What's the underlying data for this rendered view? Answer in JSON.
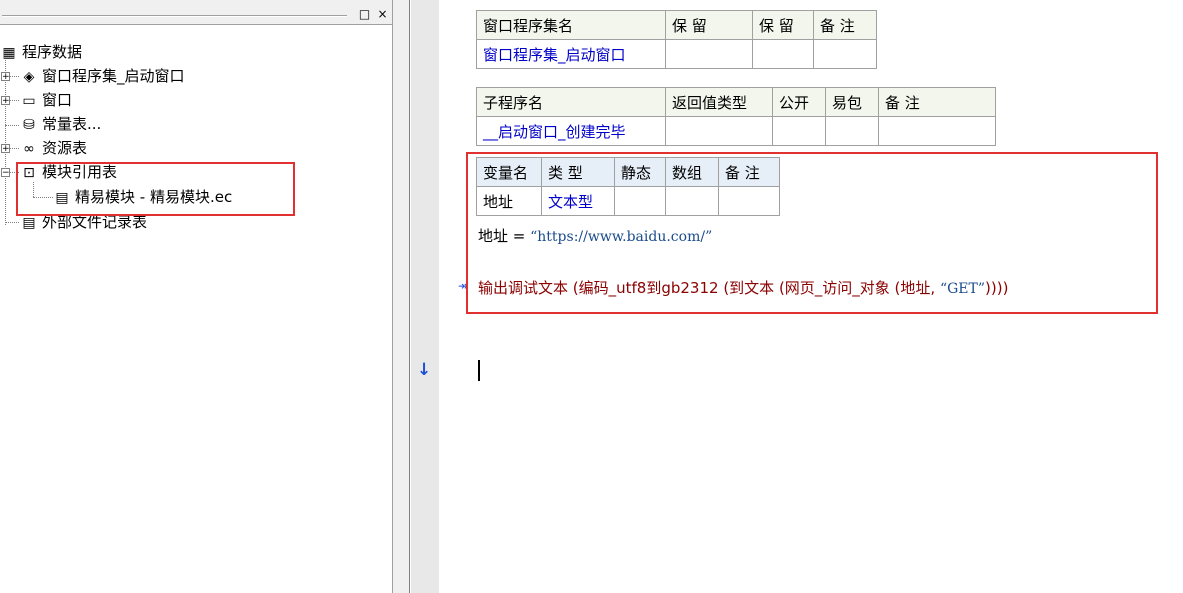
{
  "left_panel": {
    "title_buttons": {
      "restore": "□",
      "close": "×"
    },
    "tree": [
      {
        "label": "程序数据",
        "icon": "program-data-icon"
      },
      {
        "label": "窗口程序集_启动窗口",
        "icon": "assembly-icon"
      },
      {
        "label": "窗口",
        "icon": "window-icon"
      },
      {
        "label": "常量表...",
        "icon": "constant-table-icon"
      },
      {
        "label": "资源表",
        "icon": "resource-table-icon"
      },
      {
        "label": "模块引用表",
        "icon": "module-ref-icon"
      },
      {
        "label": "精易模块 - 精易模块.ec",
        "icon": "module-file-icon"
      },
      {
        "label": "外部文件记录表",
        "icon": "file-record-icon"
      }
    ]
  },
  "assembly_table": {
    "headers": [
      "窗口程序集名",
      "保 留",
      "保 留",
      "备 注"
    ],
    "row": [
      "窗口程序集_启动窗口",
      "",
      "",
      ""
    ]
  },
  "sub_table": {
    "headers": [
      "子程序名",
      "返回值类型",
      "公开",
      "易包",
      "备 注"
    ],
    "row": [
      "__启动窗口_创建完毕",
      "",
      "",
      "",
      ""
    ]
  },
  "var_table": {
    "headers": [
      "变量名",
      "类 型",
      "静态",
      "数组",
      "备 注"
    ],
    "row": [
      "地址",
      "文本型",
      "",
      "",
      ""
    ]
  },
  "code": {
    "line1_var": "地址",
    "line1_op": " = ",
    "line1_str": "“https://www.baidu.com/”",
    "line2_prefix": "输出调试文本 (编码_utf8到gb2312 (到文本 (网页_访问_对象 (地址, ",
    "line2_str": "“GET”",
    "line2_suffix": "))))",
    "exec_marker": "↠",
    "arrow_marker": "↓"
  }
}
